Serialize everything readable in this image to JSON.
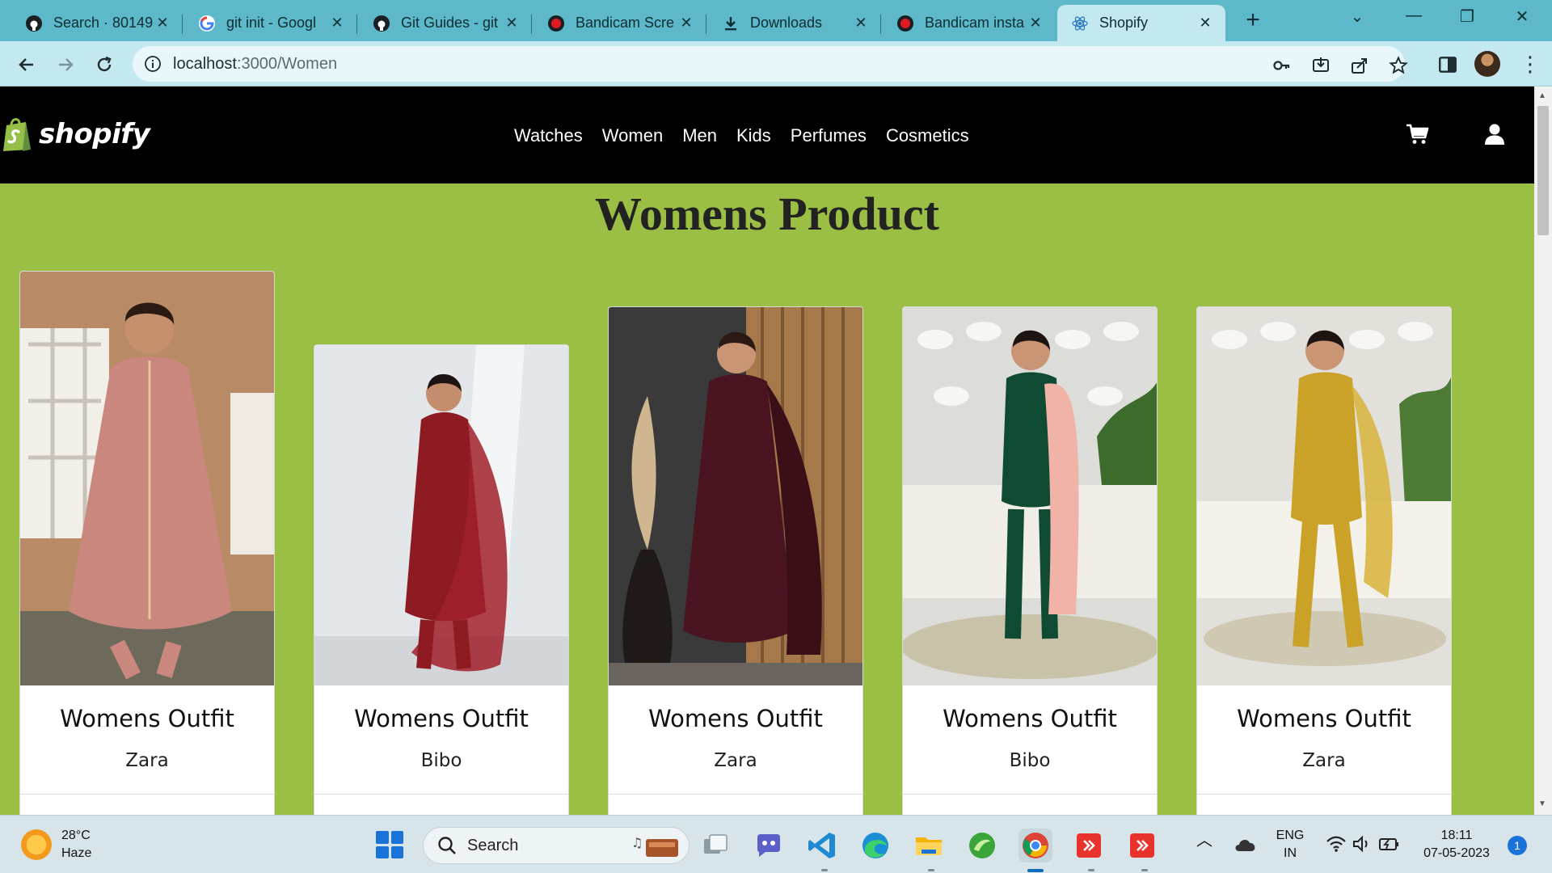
{
  "browser": {
    "tabs": [
      {
        "title": "Search · 80149",
        "icon": "github-icon"
      },
      {
        "title": "git init - Googl",
        "icon": "google-icon"
      },
      {
        "title": "Git Guides - git",
        "icon": "github-icon"
      },
      {
        "title": "Bandicam Scre",
        "icon": "record-icon"
      },
      {
        "title": "Downloads",
        "icon": "download-icon"
      },
      {
        "title": "Bandicam insta",
        "icon": "record-icon"
      },
      {
        "title": "Shopify",
        "icon": "react-icon",
        "active": true
      }
    ],
    "url_host": "localhost",
    "url_path": ":3000/Women",
    "colors": {
      "tabstrip": "#5db8c9",
      "toolbar": "#c4e8ef"
    }
  },
  "site": {
    "logo_text": "shopify",
    "nav": [
      "Watches",
      "Women",
      "Men",
      "Kids",
      "Perfumes",
      "Cosmetics"
    ],
    "page_title": "Womens Product",
    "colors": {
      "header": "#000000",
      "page_bg": "#9bbf45",
      "logo_bag": "#95bf47"
    }
  },
  "products": [
    {
      "name": "Womens Outfit",
      "brand": "Zara",
      "dress_color": "#c9877d",
      "image": "model-in-pink-kurta"
    },
    {
      "name": "Womens Outfit",
      "brand": "Bibo",
      "dress_color": "#8e1b22",
      "image": "model-in-maroon-kurta"
    },
    {
      "name": "Womens Outfit",
      "brand": "Zara",
      "dress_color": "#4a1420",
      "image": "model-in-wine-kurta"
    },
    {
      "name": "Womens Outfit",
      "brand": "Bibo",
      "dress_color": "#0f4a33",
      "image": "model-in-green-kurta"
    },
    {
      "name": "Womens Outfit",
      "brand": "Zara",
      "dress_color": "#c9a227",
      "image": "model-in-mustard-kurta"
    }
  ],
  "taskbar": {
    "temperature": "28°C",
    "weather": "Haze",
    "search_label": "Search",
    "lang_1": "ENG",
    "lang_2": "IN",
    "time": "18:11",
    "date": "07-05-2023",
    "notification_count": "1"
  }
}
